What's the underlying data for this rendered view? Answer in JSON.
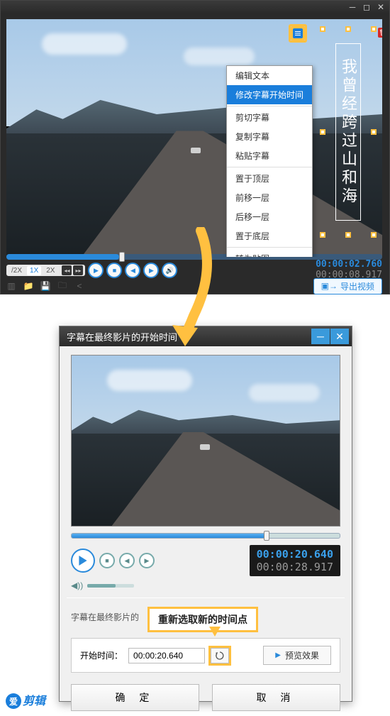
{
  "top_window": {
    "subtitle_text": "我曾经跨过山和海",
    "context_menu": [
      "编辑文本",
      "修改字幕开始时间",
      "剪切字幕",
      "复制字幕",
      "粘贴字幕",
      "置于顶层",
      "前移一层",
      "后移一层",
      "置于底层",
      "转为贴图"
    ],
    "context_highlighted_index": 1,
    "speed": {
      "half": "/2X",
      "one": "1X",
      "two": "2X"
    },
    "time_current": "00:00:02.760",
    "time_total": "00:00:08.917",
    "export_label": "导出视频"
  },
  "dialog": {
    "title": "字幕在最终影片的开始时间",
    "time_current": "00:00:20.640",
    "time_total": "00:00:28.917",
    "section_label": "字幕在最终影片的",
    "callout_text": "重新选取新的时间点",
    "start_time_label": "开始时间：",
    "start_time_value": "00:00:20.640",
    "preview_effect_label": "预览效果",
    "ok_label": "确 定",
    "cancel_label": "取 消"
  },
  "logo": {
    "char": "爱",
    "rest": "剪辑"
  }
}
